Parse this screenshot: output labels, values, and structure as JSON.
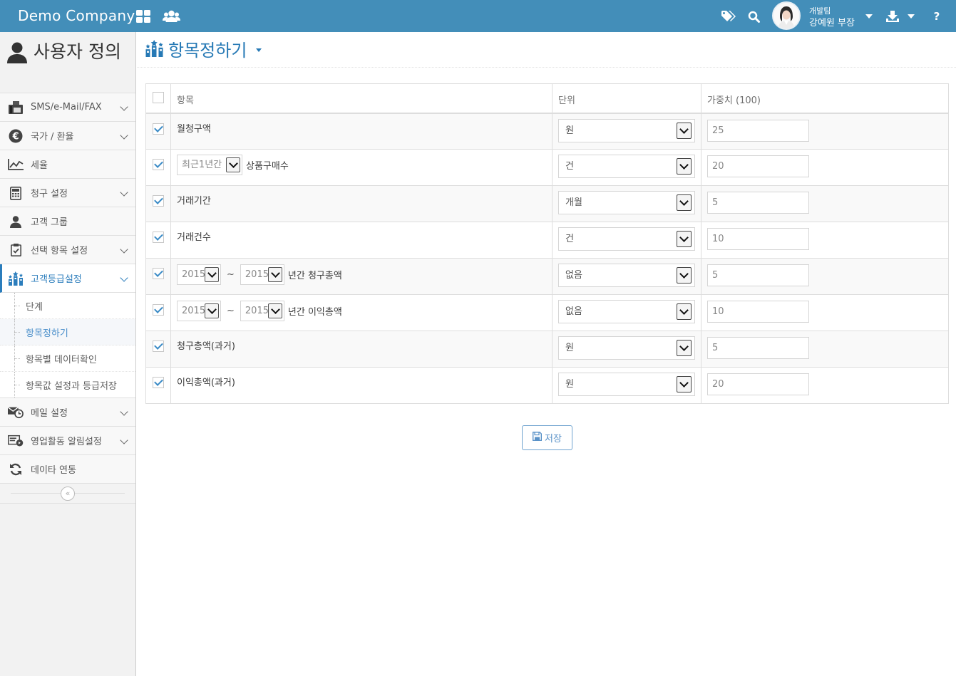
{
  "header": {
    "brand": "Demo Company",
    "user": {
      "team": "개발팀",
      "name": "강예원 부장"
    },
    "icons": [
      "grid-icon",
      "users-icon",
      "tags-icon",
      "search-icon",
      "download-icon",
      "help-icon"
    ],
    "help_label": "?",
    "bar_color": "#438eb9"
  },
  "sidebar": {
    "title": "사용자 정의",
    "items": [
      {
        "label": "SMS/e-Mail/FAX",
        "icon": "fax-icon"
      },
      {
        "label": "국가 / 환율",
        "icon": "euro-icon"
      },
      {
        "label": "세율",
        "icon": "line-chart-icon"
      },
      {
        "label": "청구 설정",
        "icon": "calculator-icon"
      },
      {
        "label": "고객 그룹",
        "icon": "user-icon"
      },
      {
        "label": "선택 항목 설정",
        "icon": "clipboard-check-icon"
      },
      {
        "label": "고객등급설정",
        "icon": "ranking-icon"
      },
      {
        "label": "메일 설정",
        "icon": "mail-clock-icon"
      },
      {
        "label": "영업활동 알림설정",
        "icon": "notice-card-icon"
      },
      {
        "label": "데이타 연동",
        "icon": "sync-icon"
      }
    ],
    "subitems": [
      {
        "label": "단계"
      },
      {
        "label": "항목정하기"
      },
      {
        "label": "항목별 데이터확인"
      },
      {
        "label": "항목값 설정과 등급저장"
      }
    ],
    "collapse_symbol": "«"
  },
  "page": {
    "title": "항목정하기",
    "columns": [
      "항목",
      "단위",
      "가중치 (100)"
    ],
    "rows": [
      {
        "checked": true,
        "label": "월청구액",
        "unit": "원",
        "weight": "25"
      },
      {
        "checked": true,
        "period": "최근1년간",
        "label": "상품구매수",
        "unit": "건",
        "weight": "20"
      },
      {
        "checked": true,
        "label": "거래기간",
        "unit": "개월",
        "weight": "5"
      },
      {
        "checked": true,
        "label": "거래건수",
        "unit": "건",
        "weight": "10"
      },
      {
        "checked": true,
        "from_year": "2015",
        "tilde": "~",
        "to_year": "2015",
        "label": "년간 청구총액",
        "unit": "없음",
        "weight": "5"
      },
      {
        "checked": true,
        "from_year": "2015",
        "tilde": "~",
        "to_year": "2015",
        "label": "년간 이익총액",
        "unit": "없음",
        "weight": "10"
      },
      {
        "checked": true,
        "label": "청구총액(과거)",
        "unit": "원",
        "weight": "5"
      },
      {
        "checked": true,
        "label": "이익총액(과거)",
        "unit": "원",
        "weight": "20"
      }
    ],
    "save_label": "저장"
  }
}
